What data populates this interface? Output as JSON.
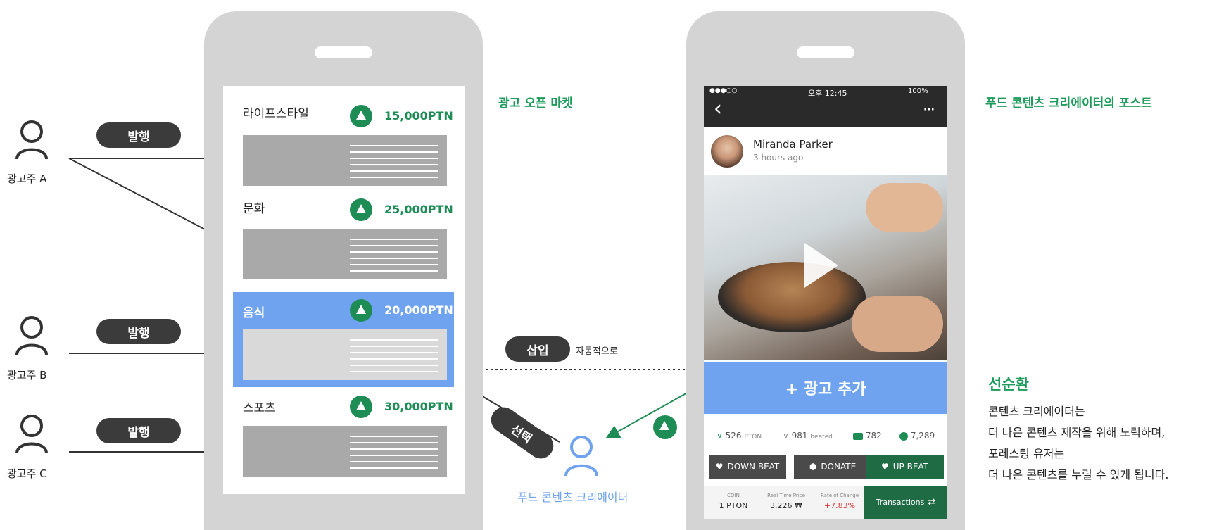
{
  "advertisers": [
    {
      "label": "광고주 A",
      "action": "발행"
    },
    {
      "label": "광고주 B",
      "action": "발행"
    },
    {
      "label": "광고주 C",
      "action": "발행"
    }
  ],
  "market": {
    "title": "광고 오픈 마켓",
    "categories": [
      {
        "name": "라이프스타일",
        "price": "15,000PTN"
      },
      {
        "name": "문화",
        "price": "25,000PTN"
      },
      {
        "name": "음식",
        "price": "20,000PTN"
      },
      {
        "name": "스포츠",
        "price": "30,000PTN"
      }
    ]
  },
  "flow": {
    "insert_label": "삽입",
    "auto_label": "자동적으로",
    "select_label": "선택",
    "creator_label": "푸드 콘텐츠 크리에이터"
  },
  "post": {
    "title": "푸드 콘텐츠 크리에이터의 포스트",
    "status_carrier": "●●●○○",
    "status_time": "오후 12:45",
    "status_battery": "100%",
    "back_glyph": "‹",
    "more_glyph": "···",
    "author": "Miranda Parker",
    "time_ago": "3 hours ago",
    "add_ad": "+ 광고 추가",
    "stats": {
      "pton": "526",
      "pton_unit": "PTON",
      "beated": "981",
      "beated_unit": "beated",
      "comments": "782",
      "checks": "7,289"
    },
    "buttons": {
      "down": "DOWN BEAT",
      "donate": "DONATE",
      "up": "UP BEAT"
    },
    "footer": {
      "coin_label": "COIN",
      "coin_value": "1 PTON",
      "price_label": "Real Time Price",
      "price_value": "3,226 ₩",
      "rate_label": "Rate of Change",
      "rate_value": "+7.83%",
      "transactions": "Transactions"
    }
  },
  "cycle": {
    "title": "선순환",
    "lines": [
      "콘텐츠 크리에이터는",
      "더 나은 콘텐츠 제작을 위해 노력하며,",
      "포레스팅 유저는",
      "더 나은 콘텐츠를 누릴 수 있게 됩니다."
    ]
  },
  "colors": {
    "green": "#1e8c55",
    "blue": "#6fa3ef",
    "dark": "#3b3b3b"
  }
}
